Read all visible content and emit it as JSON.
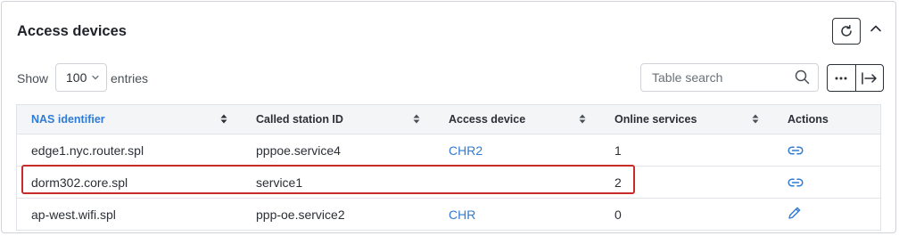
{
  "card": {
    "title": "Access devices",
    "refresh_icon": "refresh-icon",
    "collapse_icon": "chevron-up-icon"
  },
  "controls": {
    "show_label": "Show",
    "entries_value": "100",
    "entries_label": "entries",
    "search_placeholder": "Table search",
    "search_icon": "search-icon",
    "more_icon": "more-horizontal-icon",
    "expand_icon": "arrow-right-to-bar-icon"
  },
  "table": {
    "columns": [
      "NAS identifier",
      "Called station ID",
      "Access device",
      "Online services",
      "Actions"
    ],
    "sorted_column": "NAS identifier",
    "rows": [
      {
        "nas": "edge1.nyc.router.spl",
        "station": "pppoe.service4",
        "device": "CHR2",
        "online": "1",
        "action_icon": "link-icon"
      },
      {
        "nas": "dorm302.core.spl",
        "station": "service1",
        "device": "",
        "online": "2",
        "action_icon": "link-icon"
      },
      {
        "nas": "ap-west.wifi.spl",
        "station": "ppp-oe.service2",
        "device": "CHR",
        "online": "0",
        "action_icon": "pencil-icon"
      }
    ]
  },
  "colors": {
    "accent": "#2f7bd5",
    "highlight": "#c92a2a",
    "border": "#cfd3d8",
    "header_bg": "#f4f5f7"
  }
}
